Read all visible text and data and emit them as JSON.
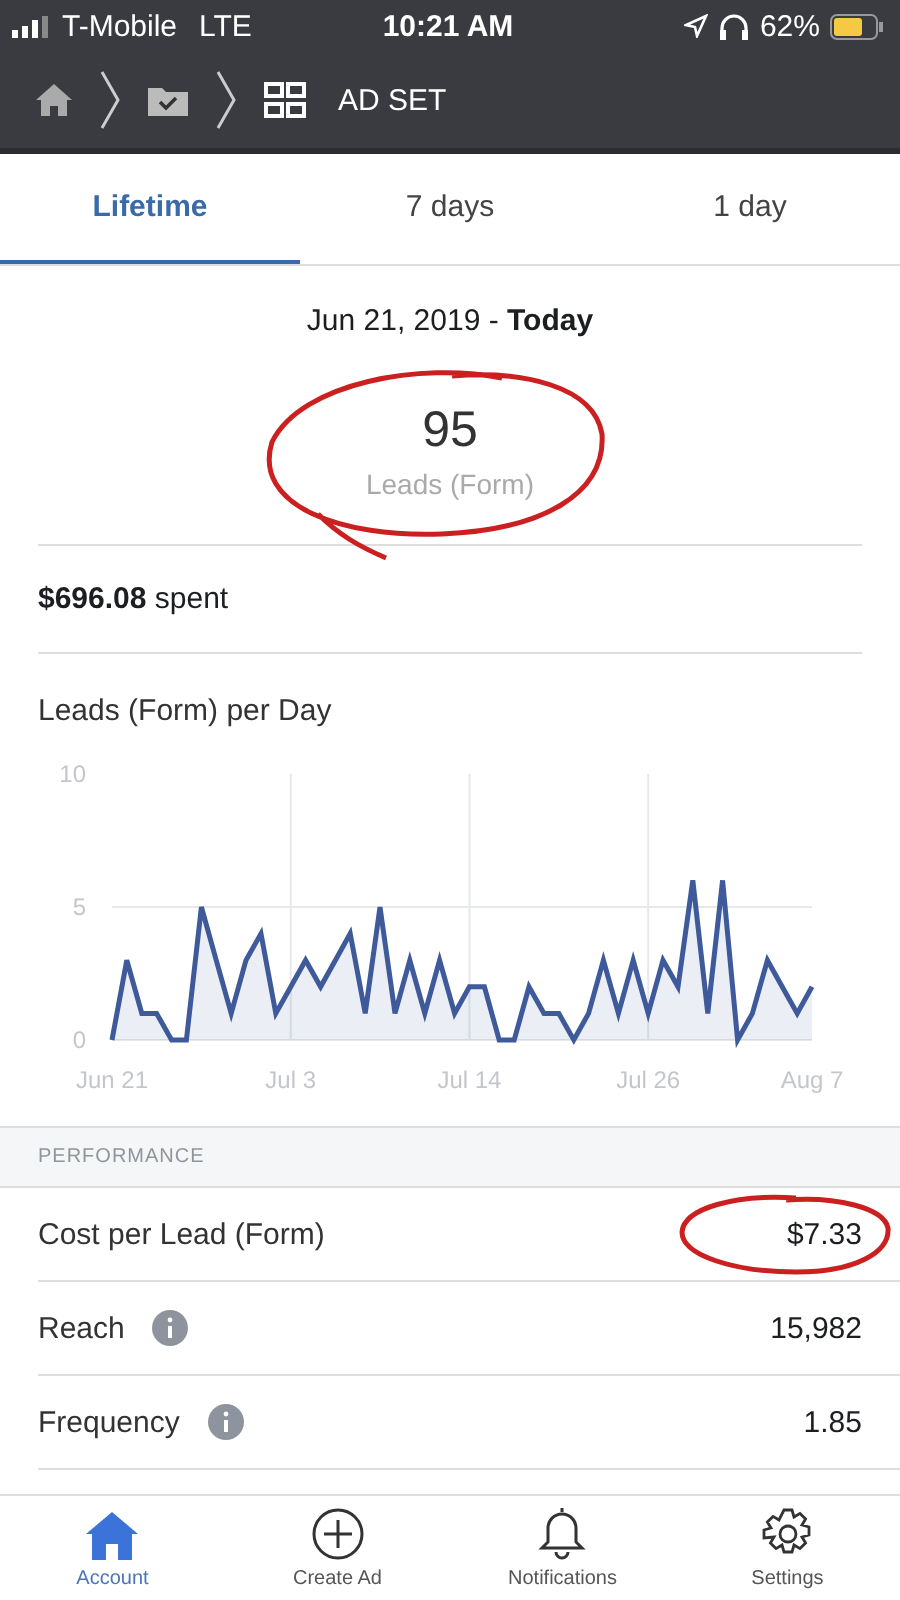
{
  "status_bar": {
    "carrier": "T-Mobile",
    "network": "LTE",
    "time": "10:21 AM",
    "battery": "62%"
  },
  "nav": {
    "title": "AD SET"
  },
  "tabs": [
    {
      "label": "Lifetime",
      "selected": true
    },
    {
      "label": "7 days",
      "selected": false
    },
    {
      "label": "1 day",
      "selected": false
    }
  ],
  "date_range": "Jun 21, 2019 - **Today**",
  "summary": {
    "value": "95",
    "label": "Leads (Form)"
  },
  "spent": "**$696.08** spent",
  "chart": {
    "chart_data": {
      "type": "area",
      "title": "Leads (Form) per Day",
      "categories": [
        "Jun 21",
        null,
        null,
        null,
        null,
        null,
        null,
        null,
        null,
        null,
        null,
        null,
        "Jul 3",
        null,
        null,
        null,
        null,
        null,
        null,
        null,
        null,
        null,
        null,
        null,
        "Jul 14",
        null,
        null,
        null,
        null,
        null,
        null,
        null,
        null,
        null,
        null,
        null,
        "Jul 26",
        null,
        null,
        null,
        null,
        null,
        null,
        null,
        null,
        null,
        null,
        "Aug 7"
      ],
      "series": [
        {
          "color": "#3f5a9a",
          "values": [
            0,
            3,
            1,
            1,
            0,
            0,
            5,
            3,
            1,
            3,
            4,
            1,
            2,
            3,
            2,
            3,
            4,
            1,
            5,
            1,
            3,
            1,
            3,
            1,
            2,
            2,
            0,
            0,
            2,
            1,
            1,
            0,
            1,
            3,
            1,
            3,
            1,
            3,
            2,
            6,
            1,
            6,
            0,
            1,
            3,
            2,
            1,
            2
          ]
        }
      ],
      "ylim": [
        0,
        10
      ],
      "yticks": [
        0,
        5,
        10
      ],
      "grid": true
    }
  },
  "performance": {
    "header": "PERFORMANCE",
    "rows": [
      {
        "label": "Cost per Lead (Form)",
        "value": "$7.33",
        "info": false
      },
      {
        "label": "Reach",
        "value": "15,982",
        "info": true
      },
      {
        "label": "Frequency",
        "value": "1.85",
        "info": true
      }
    ]
  },
  "tab_bar": [
    {
      "label": "Account",
      "kind": "home",
      "selected": true
    },
    {
      "label": "Create Ad",
      "kind": "create",
      "selected": false
    },
    {
      "label": "Notifications",
      "kind": "notifications",
      "selected": false
    },
    {
      "label": "Settings",
      "kind": "settings",
      "selected": false
    }
  ]
}
